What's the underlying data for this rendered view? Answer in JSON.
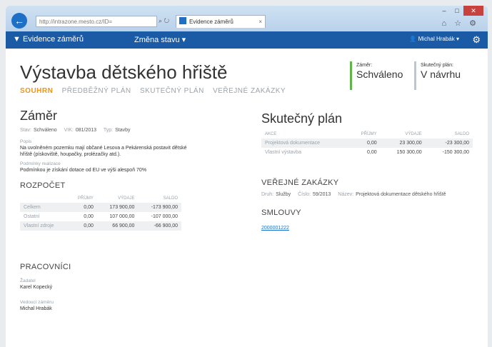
{
  "browser": {
    "address": "http://intrazone.mesto.cz/ID=",
    "tab_label": "Evidence záměrů",
    "tab_close": "×",
    "win_min": "–",
    "win_max": "□",
    "win_close": "✕",
    "tools": "⌂ ☆ ⚙"
  },
  "appbar": {
    "brand": "Evidence záměrů",
    "menu": "Změna stavu ▾",
    "user": "Michal Hrabák ▾"
  },
  "page": {
    "title": "Výstavba dětského hřiště",
    "tabs": [
      "SOUHRN",
      "PŘEDBĚŽNÝ PLÁN",
      "SKUTEČNÝ PLÁN",
      "VEŘEJNÉ ZAKÁZKY"
    ],
    "status_zamer_label": "Záměr:",
    "status_zamer_value": "Schváleno",
    "status_plan_label": "Skutečný plán:",
    "status_plan_value": "V návrhu"
  },
  "zamer": {
    "heading": "Záměr",
    "stav_k": "Stav:",
    "stav_v": "Schváleno",
    "vik_k": "VIK:",
    "vik_v": "081/2013",
    "typ_k": "Typ:",
    "typ_v": "Stavby",
    "popis_k": "Popis",
    "popis_v1": "Na uvolněném pozemku mají občané Lesova a Pekárenská postavit dětské",
    "popis_v2": "hřiště (pískoviště, houpačky, prolézačky atd.).",
    "realizace_k": "Podmínky realizace",
    "realizace_v": "Podmínkou je získání dotace od EU ve výši alespoň 70%"
  },
  "rozpocet": {
    "heading": "ROZPOČET",
    "cols": [
      "",
      "PŘÍJMY",
      "VÝDAJE",
      "SALDO"
    ],
    "rows": [
      [
        "Celkem",
        "0,00",
        "173 900,00",
        "-173 900,00"
      ],
      [
        "Ostatní",
        "0,00",
        "107 000,00",
        "-107 000,00"
      ],
      [
        "Vlastní zdroje",
        "0,00",
        "66 900,00",
        "-66 900,00"
      ]
    ]
  },
  "pracovnici": {
    "heading": "PRACOVNÍCI",
    "zadatel_k": "Žadatel",
    "zadatel_v": "Karel Kopecký",
    "vedouci_k": "Vedoucí záměru",
    "vedouci_v": "Michal Hrabák"
  },
  "skutecny": {
    "heading": "Skutečný plán",
    "cols": [
      "AKCE",
      "PŘÍJMY",
      "VÝDAJE",
      "SALDO"
    ],
    "rows": [
      [
        "Projektová dokumentace",
        "0,00",
        "23 300,00",
        "-23 300,00"
      ],
      [
        "Vlastní výstavba",
        "0,00",
        "150 300,00",
        "-150 300,00"
      ]
    ]
  },
  "zakazky": {
    "heading": "VEŘEJNÉ ZAKÁZKY",
    "druh_k": "Druh:",
    "druh_v": "Služby",
    "cislo_k": "Číslo:",
    "cislo_v": "59/2013",
    "nazev_k": "Název:",
    "nazev_v": "Projektová dokumentace dětského hřiště"
  },
  "smlouvy": {
    "heading": "SMLOUVY",
    "link": "2000001222"
  }
}
